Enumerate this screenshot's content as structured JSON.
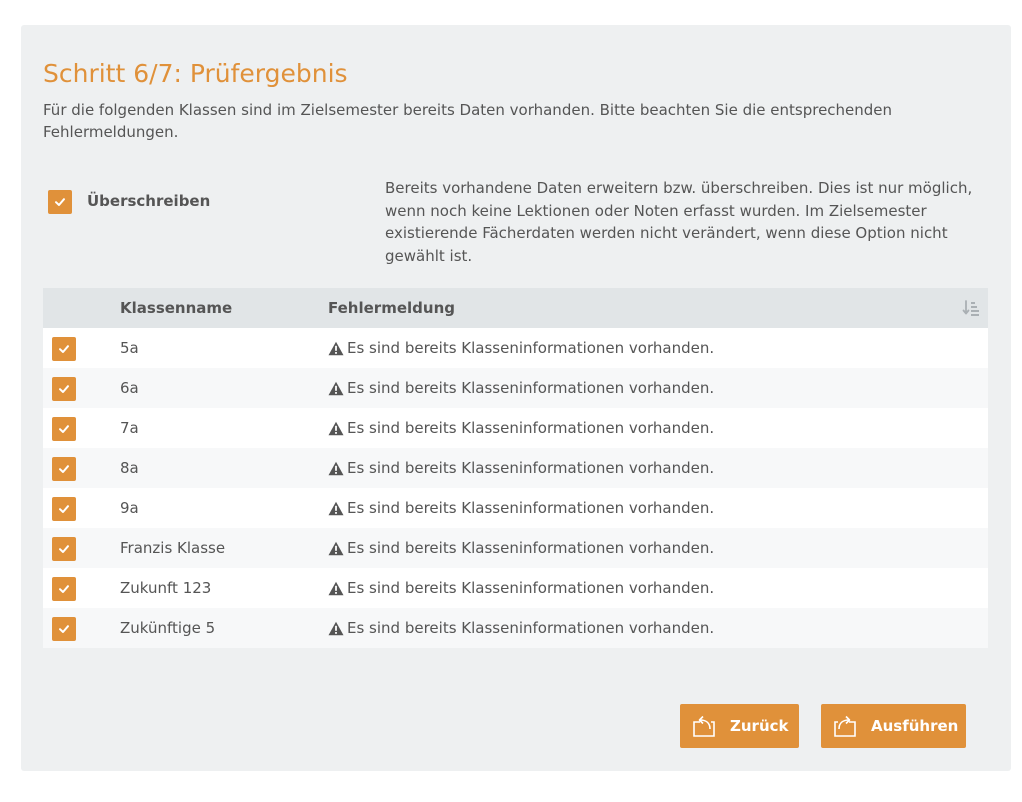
{
  "page": {
    "title": "Schritt 6/7: Prüfergebnis",
    "intro": "Für die folgenden Klassen sind im Zielsemester bereits Daten vorhanden. Bitte beachten Sie die entsprechenden Fehlermeldungen."
  },
  "overwrite": {
    "label": "Überschreiben",
    "checked": true,
    "description": "Bereits vorhandene Daten erweitern bzw. überschreiben. Dies ist nur möglich, wenn noch keine Lektionen oder Noten erfasst wurden. Im Zielsemester existierende Fächerdaten werden nicht verändert, wenn diese Option nicht gewählt ist."
  },
  "table": {
    "columns": {
      "name": "Klassenname",
      "message": "Fehlermeldung"
    },
    "rows": [
      {
        "name": "5a",
        "message": "Es sind bereits Klasseninformationen vorhanden.",
        "checked": true
      },
      {
        "name": "6a",
        "message": "Es sind bereits Klasseninformationen vorhanden.",
        "checked": true
      },
      {
        "name": "7a",
        "message": "Es sind bereits Klasseninformationen vorhanden.",
        "checked": true
      },
      {
        "name": "8a",
        "message": "Es sind bereits Klasseninformationen vorhanden.",
        "checked": true
      },
      {
        "name": "9a",
        "message": "Es sind bereits Klasseninformationen vorhanden.",
        "checked": true
      },
      {
        "name": "Franzis Klasse",
        "message": "Es sind bereits Klasseninformationen vorhanden.",
        "checked": true
      },
      {
        "name": "Zukunft 123",
        "message": "Es sind bereits Klasseninformationen vorhanden.",
        "checked": true
      },
      {
        "name": "Zukünftige 5",
        "message": "Es sind bereits Klasseninformationen vorhanden.",
        "checked": true
      }
    ]
  },
  "buttons": {
    "back": "Zurück",
    "run": "Ausführen"
  },
  "icons": {
    "checkbox": "check-icon",
    "warning": "warning-triangle-icon",
    "sort": "sort-icon",
    "back": "back-arrow-icon",
    "run": "forward-arrow-icon"
  },
  "colors": {
    "accent": "#e0913a",
    "panel": "#eef0f1",
    "header": "#e1e5e7",
    "text": "#555555"
  }
}
